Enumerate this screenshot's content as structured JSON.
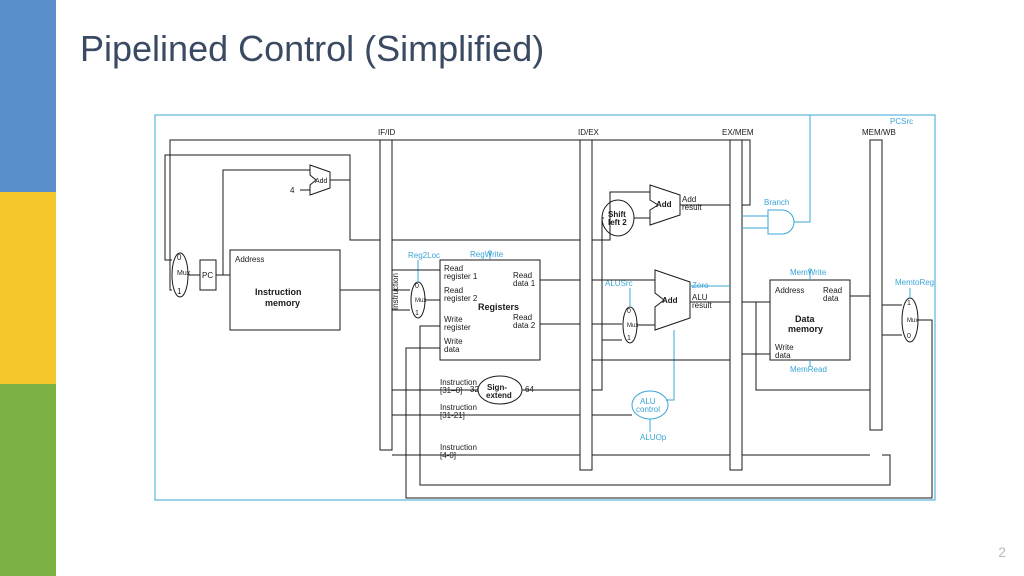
{
  "slide": {
    "title": "Pipelined Control (Simplified)",
    "pageNumber": "2"
  },
  "regs": {
    "ifid": "IF/ID",
    "idex": "ID/EX",
    "exmem": "EX/MEM",
    "memwb": "MEM/WB"
  },
  "blocks": {
    "pc": "PC",
    "imem_addr": "Address",
    "imem": "Instruction\nmemory",
    "add1": "Add",
    "const4": "4",
    "mux": "Mux",
    "mux0": "0",
    "mux1": "1",
    "instruction": "Instruction",
    "regfile": "Registers",
    "rr1": "Read\nregister 1",
    "rr2": "Read\nregister 2",
    "wr": "Write\nregister",
    "wd": "Write\ndata",
    "rd1": "Read\ndata 1",
    "rd2": "Read\ndata 2",
    "sext": "Sign-\nextend",
    "sext_in": "32",
    "sext_out": "64",
    "inst31_0": "Instruction\n[31–0]",
    "inst31_21": "Instruction\n[31-21]",
    "inst4_0": "Instruction\n[4-0]",
    "shl2": "Shift\nleft 2",
    "add2": "Add",
    "add2res": "Add\nresult",
    "alu": "ALU",
    "aluadd": "Add",
    "alures": "ALU\nresult",
    "zero": "Zero",
    "aluctrl": "ALU\ncontrol",
    "dmem": "Data\nmemory",
    "dmem_addr": "Address",
    "dmem_wd": "Write\ndata",
    "dmem_rd": "Read\ndata"
  },
  "signals": {
    "pcsrc": "PCSrc",
    "reg2loc": "Reg2Loc",
    "regwrite": "RegWrite",
    "alusrc": "ALUSrc",
    "aluop": "ALUOp",
    "branch": "Branch",
    "memwrite": "MemWrite",
    "memread": "MemRead",
    "memtoreg": "MemtoReg"
  }
}
